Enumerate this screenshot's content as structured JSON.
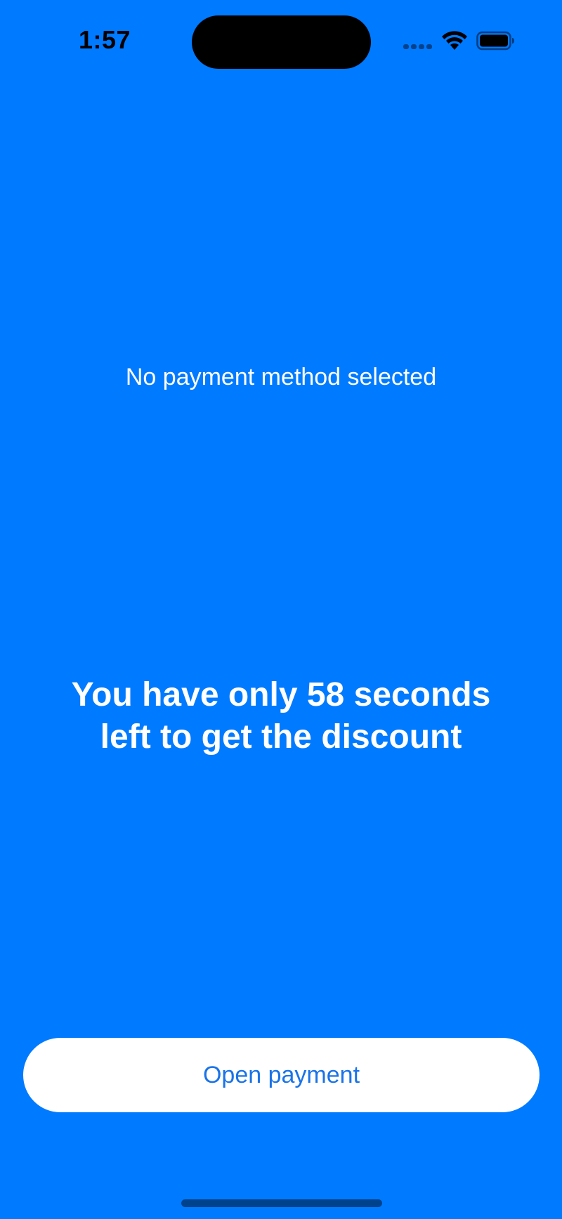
{
  "status_bar": {
    "time": "1:57",
    "icons": [
      "cellular-signal-icon",
      "wifi-icon",
      "battery-icon"
    ]
  },
  "main": {
    "payment_status": "No payment method selected",
    "countdown_message": "You have only 58 seconds left to get the discount",
    "countdown_seconds": 58
  },
  "actions": {
    "open_payment_label": "Open payment"
  },
  "colors": {
    "background": "#007AFF",
    "button_background": "#FFFFFF",
    "button_text": "#1A73E8",
    "text": "#FFFFFF"
  }
}
